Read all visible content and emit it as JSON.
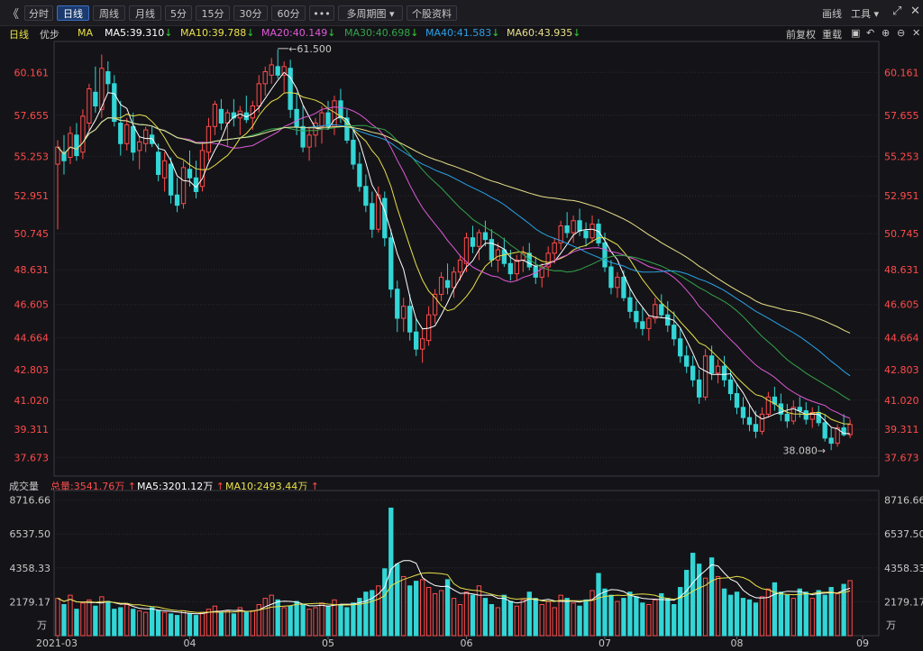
{
  "toolbar": {
    "back": "《",
    "buttons": [
      "分时",
      "日线",
      "周线",
      "月线",
      "5分",
      "15分",
      "30分",
      "60分",
      "•••",
      "多周期图 ▾",
      "个股资料"
    ],
    "active": 1,
    "right": [
      "画线",
      "工具 ▾"
    ]
  },
  "ma_bar": {
    "period": "日线",
    "adjust": "优步",
    "ma_label": "MA",
    "items": [
      {
        "text": "MA5:39.310",
        "color": "#ffffff"
      },
      {
        "text": "MA10:39.788",
        "color": "#e8e04a"
      },
      {
        "text": "MA20:40.149",
        "color": "#e05ad8"
      },
      {
        "text": "MA30:40.698",
        "color": "#34a34a"
      },
      {
        "text": "MA40:41.583",
        "color": "#2aa0e6"
      },
      {
        "text": "MA60:43.935",
        "color": "#e8e08a"
      }
    ],
    "right": [
      "前复权",
      "重载"
    ]
  },
  "volume_bar": {
    "label": "成交量",
    "total": "总量:3541.76万",
    "ma5": "MA5:3201.12万",
    "ma10": "MA10:2493.44万"
  },
  "chart_data": {
    "type": "candlestick",
    "price_ticks": [
      "60.161",
      "57.655",
      "55.253",
      "52.951",
      "50.745",
      "48.631",
      "46.605",
      "44.664",
      "42.803",
      "41.020",
      "39.311",
      "37.673"
    ],
    "volume_ticks": [
      "8716.66",
      "6537.50",
      "4358.33",
      "2179.17"
    ],
    "volume_unit": "万",
    "x_ticks": [
      "2021-03",
      "04",
      "05",
      "06",
      "07",
      "08",
      "09"
    ],
    "annotations": {
      "high": "61.500",
      "low": "38.080"
    },
    "colors": {
      "up": "#ff4b4b",
      "down": "#33d6d6"
    },
    "x_range": [
      0,
      130
    ],
    "ohlc": [
      [
        0,
        54.8,
        56.2,
        51.0,
        55.8
      ],
      [
        1,
        55.5,
        56.5,
        54.2,
        55.0
      ],
      [
        2,
        55.2,
        57.0,
        54.8,
        56.6
      ],
      [
        3,
        56.5,
        57.2,
        55.0,
        55.3
      ],
      [
        4,
        55.5,
        58.0,
        55.1,
        57.6
      ],
      [
        5,
        57.2,
        59.5,
        56.8,
        59.2
      ],
      [
        6,
        59.0,
        60.5,
        57.8,
        58.2
      ],
      [
        7,
        58.0,
        61.2,
        57.5,
        60.4
      ],
      [
        8,
        60.2,
        60.8,
        59.0,
        59.5
      ],
      [
        9,
        59.5,
        60.0,
        57.0,
        57.3
      ],
      [
        10,
        57.2,
        58.5,
        55.3,
        56.0
      ],
      [
        11,
        56.0,
        57.5,
        55.6,
        57.1
      ],
      [
        12,
        57.0,
        57.8,
        55.0,
        55.5
      ],
      [
        13,
        55.6,
        56.4,
        54.5,
        56.1
      ],
      [
        14,
        56.0,
        57.0,
        55.5,
        56.8
      ],
      [
        15,
        56.5,
        57.0,
        55.8,
        56.0
      ],
      [
        16,
        55.5,
        56.0,
        53.8,
        54.2
      ],
      [
        17,
        54.0,
        55.5,
        53.2,
        55.0
      ],
      [
        18,
        54.8,
        55.2,
        52.5,
        53.0
      ],
      [
        19,
        53.0,
        54.0,
        52.0,
        52.4
      ],
      [
        20,
        52.5,
        55.0,
        52.2,
        54.6
      ],
      [
        21,
        54.5,
        55.6,
        53.5,
        54.0
      ],
      [
        22,
        54.0,
        55.0,
        52.8,
        53.2
      ],
      [
        23,
        53.5,
        56.0,
        53.2,
        55.6
      ],
      [
        24,
        55.5,
        57.5,
        55.0,
        57.0
      ],
      [
        25,
        57.0,
        58.5,
        56.5,
        58.3
      ],
      [
        26,
        58.0,
        58.6,
        56.8,
        57.2
      ],
      [
        27,
        57.2,
        58.0,
        55.8,
        57.8
      ],
      [
        28,
        57.8,
        58.6,
        57.0,
        57.5
      ],
      [
        29,
        57.5,
        58.2,
        56.5,
        57.9
      ],
      [
        30,
        57.8,
        58.8,
        57.2,
        57.4
      ],
      [
        31,
        57.5,
        58.5,
        56.8,
        58.2
      ],
      [
        32,
        58.2,
        60.0,
        57.8,
        59.5
      ],
      [
        33,
        59.5,
        60.5,
        58.8,
        60.2
      ],
      [
        34,
        60.0,
        61.0,
        59.5,
        60.6
      ],
      [
        35,
        60.5,
        61.5,
        59.8,
        60.0
      ],
      [
        36,
        60.0,
        60.8,
        59.0,
        60.5
      ],
      [
        37,
        60.4,
        60.9,
        57.5,
        58.0
      ],
      [
        38,
        58.0,
        59.0,
        56.5,
        57.0
      ],
      [
        39,
        57.0,
        58.2,
        55.5,
        55.8
      ],
      [
        40,
        55.8,
        57.0,
        55.0,
        56.5
      ],
      [
        41,
        56.5,
        57.5,
        55.8,
        57.2
      ],
      [
        42,
        57.0,
        58.2,
        56.0,
        57.8
      ],
      [
        43,
        57.8,
        58.5,
        56.8,
        57.0
      ],
      [
        44,
        57.0,
        58.8,
        56.5,
        58.5
      ],
      [
        45,
        58.5,
        59.2,
        57.2,
        57.5
      ],
      [
        46,
        57.5,
        58.0,
        56.0,
        56.2
      ],
      [
        47,
        56.2,
        57.0,
        54.5,
        54.8
      ],
      [
        48,
        54.8,
        55.5,
        53.2,
        53.5
      ],
      [
        49,
        53.5,
        54.2,
        52.0,
        52.4
      ],
      [
        50,
        52.5,
        53.2,
        50.5,
        51.0
      ],
      [
        51,
        51.0,
        53.5,
        50.8,
        53.0
      ],
      [
        52,
        52.8,
        53.2,
        50.0,
        50.5
      ],
      [
        53,
        50.5,
        51.0,
        47.0,
        47.5
      ],
      [
        54,
        47.5,
        48.0,
        45.0,
        45.8
      ],
      [
        55,
        45.8,
        47.0,
        45.0,
        46.5
      ],
      [
        56,
        46.5,
        47.2,
        44.5,
        45.0
      ],
      [
        57,
        45.0,
        45.8,
        43.6,
        44.0
      ],
      [
        58,
        44.0,
        45.2,
        43.2,
        44.6
      ],
      [
        59,
        44.5,
        46.5,
        44.2,
        46.0
      ],
      [
        60,
        46.0,
        47.5,
        45.5,
        47.2
      ],
      [
        61,
        47.2,
        48.5,
        46.8,
        48.2
      ],
      [
        62,
        48.0,
        49.0,
        47.2,
        47.6
      ],
      [
        63,
        47.6,
        48.8,
        47.0,
        48.5
      ],
      [
        64,
        48.5,
        49.5,
        48.0,
        49.2
      ],
      [
        65,
        49.0,
        50.8,
        48.5,
        50.5
      ],
      [
        66,
        50.5,
        51.2,
        49.6,
        50.0
      ],
      [
        67,
        50.0,
        51.0,
        49.2,
        50.8
      ],
      [
        68,
        50.8,
        51.5,
        50.0,
        50.4
      ],
      [
        69,
        50.4,
        51.0,
        48.8,
        49.2
      ],
      [
        70,
        49.2,
        50.2,
        48.5,
        49.8
      ],
      [
        71,
        49.8,
        50.5,
        48.8,
        49.0
      ],
      [
        72,
        49.0,
        49.8,
        48.0,
        48.4
      ],
      [
        73,
        48.4,
        49.5,
        48.0,
        49.2
      ],
      [
        74,
        49.2,
        50.0,
        48.5,
        49.6
      ],
      [
        75,
        49.6,
        50.2,
        48.6,
        48.8
      ],
      [
        76,
        48.8,
        49.4,
        47.8,
        48.2
      ],
      [
        77,
        48.2,
        49.0,
        47.6,
        48.8
      ],
      [
        78,
        48.8,
        50.0,
        48.2,
        49.6
      ],
      [
        79,
        49.6,
        50.5,
        49.0,
        50.2
      ],
      [
        80,
        50.2,
        51.5,
        49.8,
        51.2
      ],
      [
        81,
        51.2,
        52.0,
        50.5,
        50.8
      ],
      [
        82,
        50.8,
        51.8,
        50.2,
        51.5
      ],
      [
        83,
        51.5,
        52.2,
        50.6,
        50.9
      ],
      [
        84,
        50.9,
        51.4,
        50.0,
        50.5
      ],
      [
        85,
        50.5,
        51.8,
        50.2,
        51.3
      ],
      [
        86,
        51.3,
        51.6,
        50.0,
        50.2
      ],
      [
        87,
        50.2,
        50.8,
        48.5,
        48.8
      ],
      [
        88,
        48.8,
        49.2,
        47.2,
        47.6
      ],
      [
        89,
        47.6,
        48.5,
        47.0,
        48.2
      ],
      [
        90,
        48.2,
        48.6,
        46.8,
        47.0
      ],
      [
        91,
        47.0,
        47.6,
        45.8,
        46.2
      ],
      [
        92,
        46.2,
        46.8,
        45.2,
        45.6
      ],
      [
        93,
        45.6,
        46.4,
        44.8,
        45.2
      ],
      [
        94,
        45.2,
        46.0,
        44.5,
        45.8
      ],
      [
        95,
        45.8,
        47.0,
        45.5,
        46.6
      ],
      [
        96,
        46.6,
        47.2,
        45.8,
        46.0
      ],
      [
        97,
        46.0,
        46.8,
        45.0,
        45.4
      ],
      [
        98,
        45.4,
        46.2,
        44.2,
        44.6
      ],
      [
        99,
        44.6,
        45.2,
        43.2,
        43.6
      ],
      [
        100,
        43.6,
        44.2,
        42.6,
        43.0
      ],
      [
        101,
        43.0,
        43.6,
        41.8,
        42.2
      ],
      [
        102,
        42.2,
        42.8,
        40.8,
        41.2
      ],
      [
        103,
        41.2,
        44.0,
        41.0,
        43.6
      ],
      [
        104,
        43.6,
        44.2,
        42.2,
        42.6
      ],
      [
        105,
        42.6,
        43.4,
        42.0,
        43.0
      ],
      [
        106,
        43.0,
        43.6,
        41.8,
        42.2
      ],
      [
        107,
        42.2,
        42.8,
        41.0,
        41.4
      ],
      [
        108,
        41.4,
        42.0,
        40.2,
        40.6
      ],
      [
        109,
        40.6,
        41.2,
        39.6,
        40.0
      ],
      [
        110,
        40.0,
        40.8,
        39.2,
        39.6
      ],
      [
        111,
        39.6,
        40.4,
        38.8,
        39.2
      ],
      [
        112,
        39.2,
        40.6,
        39.0,
        40.2
      ],
      [
        113,
        40.2,
        41.5,
        40.0,
        41.2
      ],
      [
        114,
        41.2,
        41.8,
        40.4,
        40.8
      ],
      [
        115,
        40.8,
        41.4,
        39.8,
        40.2
      ],
      [
        116,
        40.2,
        40.8,
        39.4,
        39.8
      ],
      [
        117,
        39.8,
        41.0,
        39.6,
        40.6
      ],
      [
        118,
        40.6,
        41.2,
        40.0,
        40.4
      ],
      [
        119,
        40.4,
        40.9,
        39.6,
        39.9
      ],
      [
        120,
        39.9,
        40.6,
        39.4,
        40.3
      ],
      [
        121,
        40.3,
        40.7,
        39.5,
        39.7
      ],
      [
        122,
        39.7,
        40.2,
        38.6,
        38.8
      ],
      [
        123,
        38.8,
        39.4,
        38.1,
        38.5
      ],
      [
        124,
        38.5,
        39.6,
        38.3,
        39.4
      ],
      [
        125,
        39.4,
        40.2,
        38.9,
        39.0
      ],
      [
        126,
        39.0,
        39.9,
        38.8,
        39.6
      ]
    ],
    "volume": [
      2400,
      2000,
      2600,
      1700,
      2100,
      2300,
      1900,
      2500,
      2200,
      1700,
      1800,
      2000,
      1700,
      1600,
      1500,
      1800,
      1600,
      1500,
      1400,
      1300,
      1600,
      1400,
      1300,
      1500,
      1700,
      1900,
      1500,
      1600,
      1400,
      1800,
      1500,
      1600,
      2000,
      2400,
      2600,
      2300,
      1800,
      1900,
      2200,
      2000,
      1700,
      1800,
      2100,
      1900,
      2300,
      2000,
      1800,
      2100,
      2400,
      2800,
      2900,
      3200,
      4300,
      8200,
      4600,
      3800,
      3200,
      3500,
      3600,
      3100,
      2700,
      2900,
      3600,
      2400,
      2000,
      2800,
      2600,
      3200,
      2400,
      2000,
      1800,
      2600,
      2200,
      1900,
      2300,
      2800,
      2400,
      2000,
      2200,
      1800,
      2600,
      2400,
      2100,
      1900,
      2300,
      2900,
      4000,
      3000,
      2600,
      2200,
      2400,
      2800,
      2500,
      2100,
      2000,
      2300,
      2700,
      2400,
      2000,
      3100,
      4200,
      5300,
      4600,
      3700,
      5000,
      3800,
      3000,
      2600,
      2800,
      2400,
      2300,
      2100,
      2500,
      3000,
      3400,
      2800,
      2600,
      2400,
      3000,
      2800,
      2400,
      2900,
      2600,
      3100,
      2700,
      3300,
      3540
    ]
  }
}
